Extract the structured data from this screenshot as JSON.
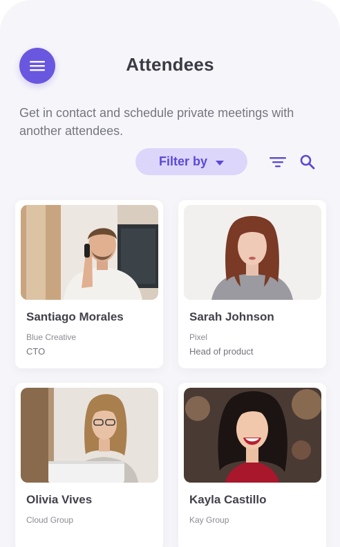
{
  "header": {
    "title": "Attendees",
    "menu_icon": "hamburger-menu-icon"
  },
  "intro": "Get in contact and schedule private meetings with another attendees.",
  "toolbar": {
    "filter_label": "Filter by",
    "filter_icon": "filter-lines-icon",
    "search_icon": "search-icon"
  },
  "colors": {
    "accent": "#6a57e0",
    "accent_light": "#dcd6fb",
    "background": "#f6f6fa",
    "card": "#ffffff"
  },
  "attendees": [
    {
      "name": "Santiago Morales",
      "company": "Blue Creative",
      "role": "CTO"
    },
    {
      "name": "Sarah Johnson",
      "company": "Pixel",
      "role": "Head of product"
    },
    {
      "name": "Olivia Vives",
      "company": "Cloud Group",
      "role": ""
    },
    {
      "name": "Kayla Castillo",
      "company": "Kay Group",
      "role": ""
    }
  ]
}
